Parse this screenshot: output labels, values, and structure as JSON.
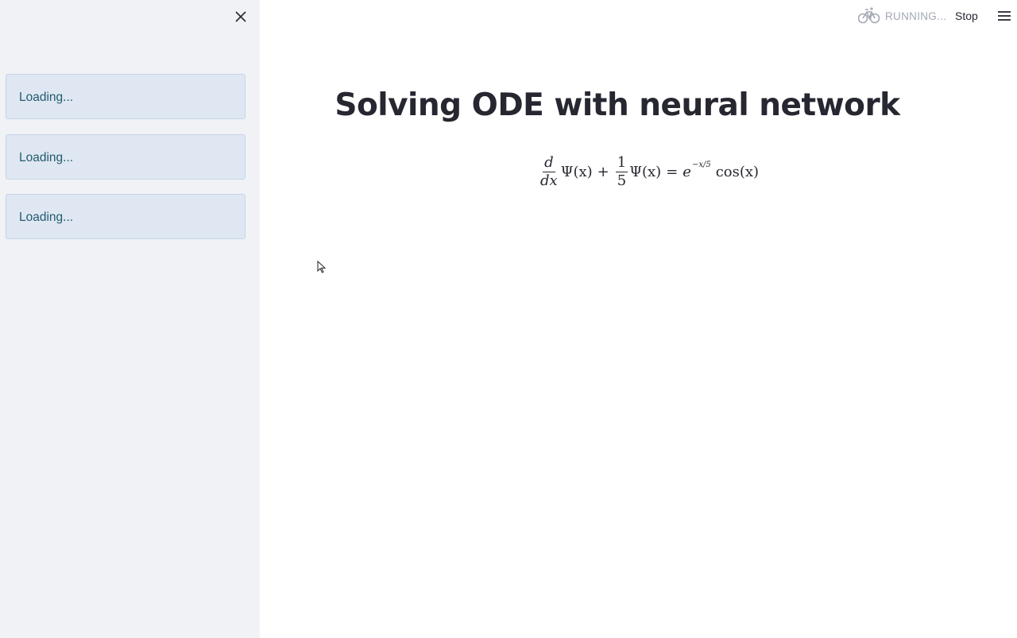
{
  "sidebar": {
    "close_icon": "close-icon",
    "loading_items": [
      {
        "label": "Loading..."
      },
      {
        "label": "Loading..."
      },
      {
        "label": "Loading..."
      }
    ]
  },
  "header": {
    "status_icon": "bicycle-icon",
    "status_text": "RUNNING...",
    "stop_label": "Stop",
    "menu_icon": "hamburger-menu-icon"
  },
  "main": {
    "title": "Solving ODE with neural network",
    "equation": {
      "frac1_num": "d",
      "frac1_den": "dx",
      "psi1": "Ψ(x)",
      "plus": "+",
      "frac2_num": "1",
      "frac2_den": "5",
      "psi2": "Ψ(x)",
      "equals": "=",
      "e": "e",
      "exponent": "−x/5",
      "cos": "cos(x)"
    }
  },
  "colors": {
    "sidebar_bg": "#f0f2f6",
    "loading_bg": "#dfe7f2",
    "loading_text": "#245b6f",
    "title_text": "#262730",
    "status_text": "#a3a8b4"
  }
}
